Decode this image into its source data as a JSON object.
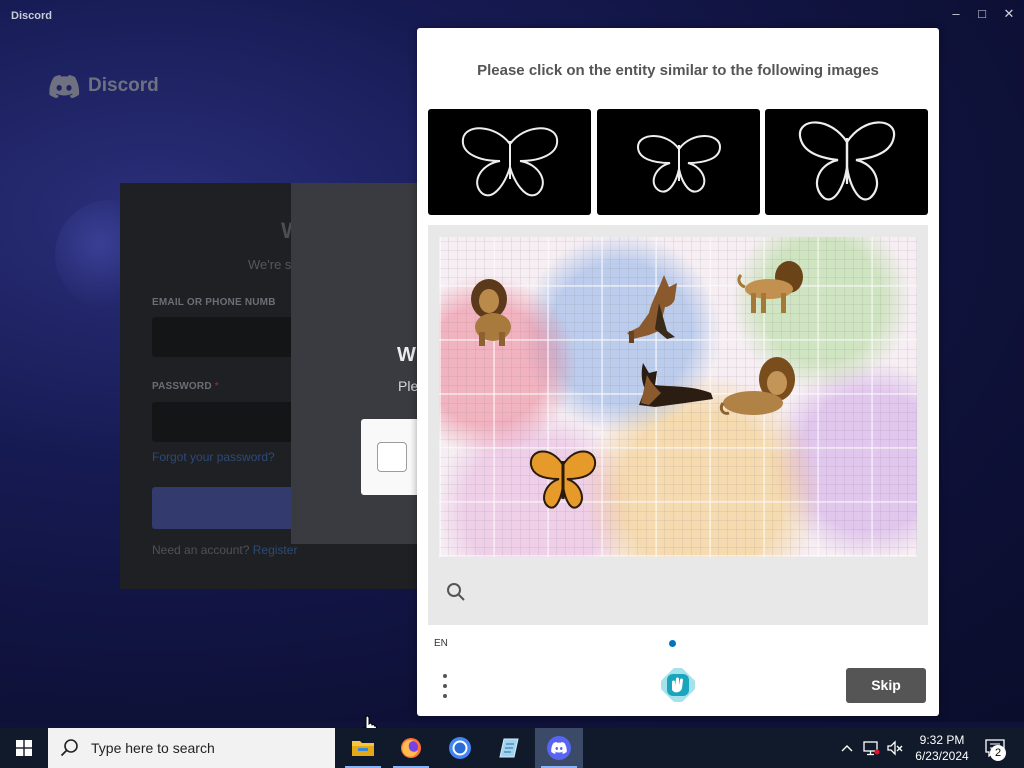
{
  "app": {
    "title": "Discord",
    "brand": "Discord"
  },
  "login": {
    "heading": "W",
    "subtext": "We're s",
    "email_label": "EMAIL OR PHONE NUMB",
    "password_label": "PASSWORD",
    "password_required": "*",
    "forgot_link": "Forgot your password?",
    "need_account": "Need an account?",
    "register_link": "Register"
  },
  "verify_modal": {
    "heading": "W",
    "subtext": "Ple"
  },
  "challenge": {
    "prompt": "Please click on the entity similar to the following images",
    "example_images": [
      "butterfly-example-1",
      "butterfly-example-2",
      "butterfly-example-3"
    ],
    "task_entities": [
      "lion",
      "dog",
      "lion",
      "dog",
      "lion",
      "butterfly"
    ],
    "language": "EN",
    "skip_label": "Skip",
    "accent_color": "#0074bf"
  },
  "taskbar": {
    "search_placeholder": "Type here to search",
    "apps": [
      "file-explorer",
      "firefox",
      "chrome",
      "notepad",
      "discord"
    ],
    "time": "9:32 PM",
    "date": "6/23/2024",
    "notification_count": "2"
  }
}
